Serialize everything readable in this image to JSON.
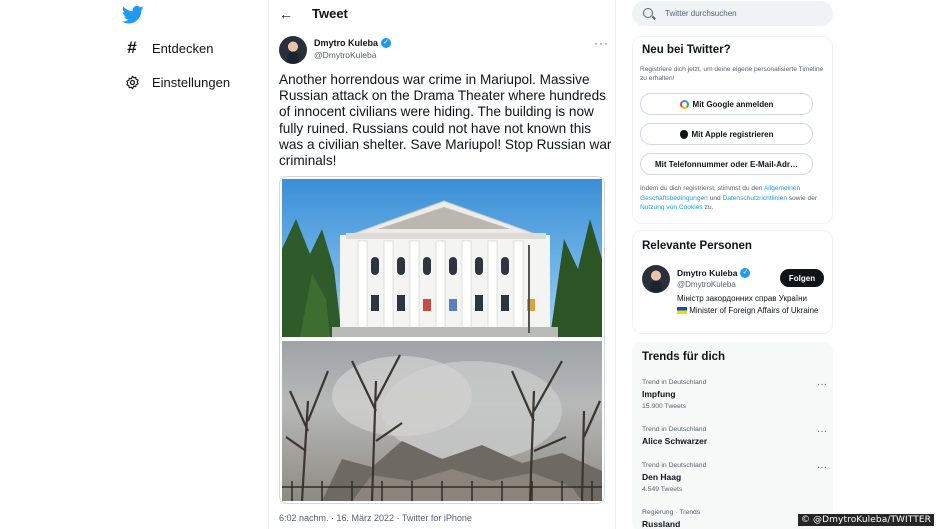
{
  "nav": {
    "items": [
      {
        "label": "Entdecken",
        "icon": "hashtag-icon"
      },
      {
        "label": "Einstellungen",
        "icon": "gear-icon"
      }
    ]
  },
  "header": {
    "title": "Tweet"
  },
  "tweet": {
    "author_name": "Dmytro Kuleba",
    "author_handle": "@DmytroKuleba",
    "text": "Another horrendous war crime in Mariupol. Massive Russian attack on the Drama Theater where hundreds of innocent civilians were hiding. The building is now fully ruined. Russians could not have not known this was a civilian shelter. Save Mariupol! Stop Russian war criminals!",
    "timestamp": "6:02 nachm. · 16. März 2022 · Twitter for iPhone"
  },
  "search": {
    "placeholder": "Twitter durchsuchen"
  },
  "signup": {
    "title": "Neu bei Twitter?",
    "description": "Registriere dich jetzt, um deine eigene personalisierte Timeline zu erhalten!",
    "google_label": "Mit Google anmelden",
    "apple_label": "Mit Apple registrieren",
    "phone_label": "Mit Telefonnummer oder E-Mail-Adr…",
    "legal_prefix": "Indem du dich registrierst, stimmst du den ",
    "legal_link1": "Allgemeinen Geschäftsbedingungen",
    "legal_and": " und ",
    "legal_link2": "Datenschutzrichtlinien",
    "legal_mid": " sowie der ",
    "legal_link3": "Nutzung von Cookies",
    "legal_suffix": " zu."
  },
  "people": {
    "title": "Relevante Personen",
    "name": "Dmytro Kuleba",
    "handle": "@DmytroKuleba",
    "follow_label": "Folgen",
    "bio_line1": "Міністр закордонних справ України",
    "bio_line2": "Minister of Foreign Affairs of Ukraine"
  },
  "trends": {
    "title": "Trends für dich",
    "items": [
      {
        "category": "Trend in Deutschland",
        "name": "Impfung",
        "count": "15.900 Tweets"
      },
      {
        "category": "Trend in Deutschland",
        "name": "Alice Schwarzer",
        "count": ""
      },
      {
        "category": "Trend in Deutschland",
        "name": "Den Haag",
        "count": "4.549 Tweets"
      },
      {
        "category": "Regierung · Trends",
        "name": "Russland",
        "count": ""
      }
    ]
  },
  "credit": "© @DmytroKuleba/TWITTER",
  "colors": {
    "accent": "#1d9bf0",
    "text": "#0f1419",
    "muted": "#536471"
  }
}
